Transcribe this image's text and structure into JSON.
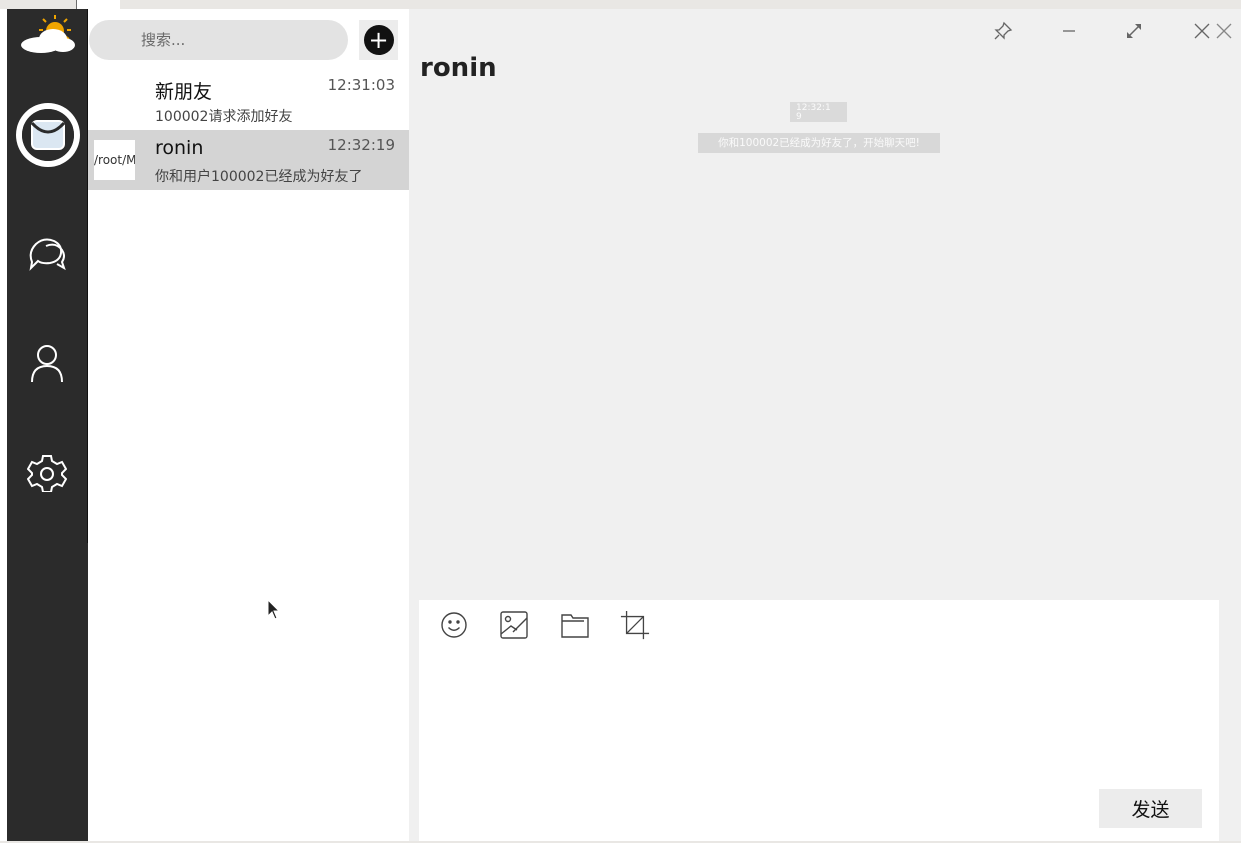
{
  "app": {
    "logo_icon": "weather-cloud-sun-icon"
  },
  "sidebar": {
    "avatar_icon": "mailbox-avatar-icon",
    "items": [
      {
        "name": "chat",
        "icon": "chat-bubbles-icon"
      },
      {
        "name": "contacts",
        "icon": "person-icon"
      },
      {
        "name": "settings",
        "icon": "gear-icon"
      }
    ]
  },
  "search": {
    "placeholder": "搜索..."
  },
  "add_button": {
    "icon": "plus-icon",
    "label": "+"
  },
  "conversations": [
    {
      "name": "新朋友",
      "time": "12:31:03",
      "preview": "100002请求添加好友",
      "thumb": ""
    },
    {
      "name": "ronin",
      "time": "12:32:19",
      "preview": "你和用户100002已经成为好友了",
      "thumb": "/root/M"
    }
  ],
  "window_controls": [
    {
      "name": "pin",
      "icon": "pin-icon"
    },
    {
      "name": "minimize",
      "icon": "minimize-icon"
    },
    {
      "name": "maximize",
      "icon": "expand-icon"
    },
    {
      "name": "close",
      "icon": "close-icon"
    }
  ],
  "chat": {
    "title": "ronin",
    "timestamp": "12:32:1",
    "timestamp_sub": "9",
    "system_message": "你和100002已经成为好友了，开始聊天吧!"
  },
  "toolbar": {
    "tools": [
      {
        "name": "emoji",
        "icon": "smiley-icon"
      },
      {
        "name": "image",
        "icon": "image-icon"
      },
      {
        "name": "file",
        "icon": "folder-icon"
      },
      {
        "name": "screenshot",
        "icon": "crop-icon"
      }
    ],
    "send_label": "发送"
  },
  "colors": {
    "sidebar_bg": "#2b2b2b",
    "selected_row": "#d4d4d4",
    "chat_bg": "#f0f0f0"
  }
}
